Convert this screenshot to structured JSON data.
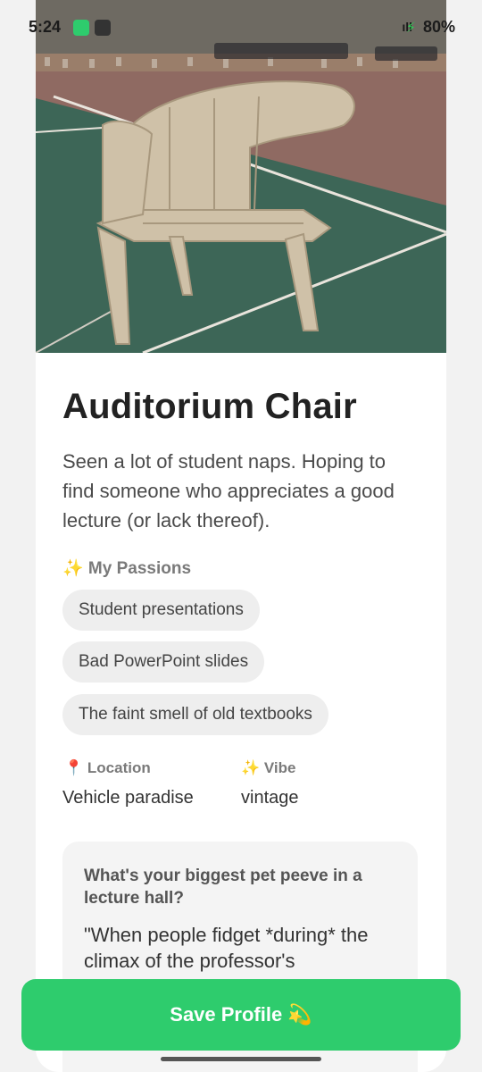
{
  "status_bar": {
    "time": "5:24",
    "battery": "80%",
    "signal": "ıll"
  },
  "profile": {
    "name": "Auditorium Chair",
    "bio": "Seen a lot of student naps. Hoping to find someone who appreciates a good lecture (or lack thereof).",
    "passions_heading": "✨ My Passions",
    "passions": [
      "Student presentations",
      "Bad PowerPoint slides",
      "The faint smell of old textbooks"
    ],
    "location_label": "Location",
    "location_value": "Vehicle paradise",
    "vibe_label": "✨ Vibe",
    "vibe_value": "vintage",
    "question": "What's your biggest pet peeve in a lecture hall?",
    "answer": "\"When people fidget *during* the climax of the professor's"
  },
  "save_button": {
    "label": "Save Profile 💫"
  },
  "icons": {
    "location": "pin-icon"
  },
  "colors": {
    "accent": "#2ecc6d",
    "chip_bg": "#eeeeee"
  }
}
